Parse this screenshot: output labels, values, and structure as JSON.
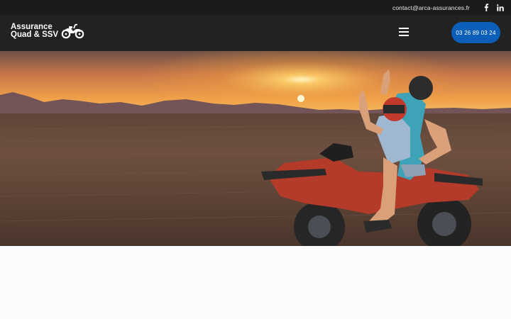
{
  "topbar": {
    "email": "contact@arca-assurances.fr",
    "social": [
      {
        "name": "facebook-icon"
      },
      {
        "name": "linkedin-icon"
      }
    ]
  },
  "header": {
    "logo_line1": "Assurance",
    "logo_line2": "Quad & SSV",
    "menu_icon": "hamburger-menu-icon",
    "phone": "03 26 89 03 24"
  },
  "hero": {
    "image_subject": "Two riders on a red quad bike in the desert at sunset"
  },
  "colors": {
    "topbar": "#1b1b1b",
    "navbar": "#222222",
    "accent": "#0c5fb8",
    "page": "#fbfcfe"
  }
}
